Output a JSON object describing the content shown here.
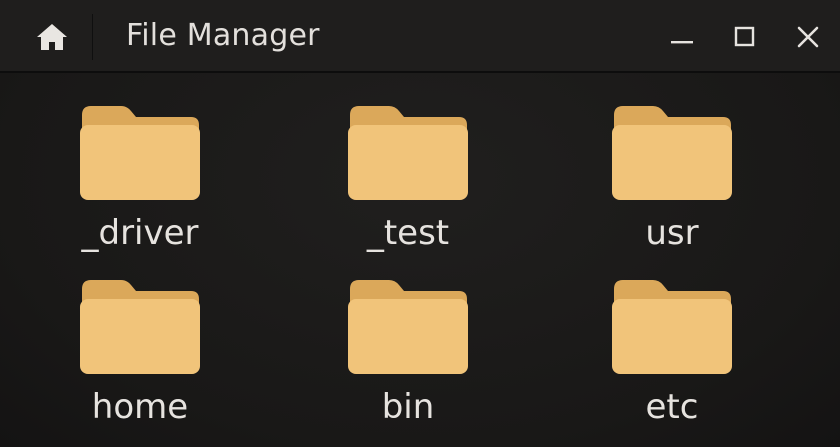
{
  "window": {
    "title": "File Manager"
  },
  "toolbar": {
    "home_icon": "home-icon",
    "minimize_icon": "minimize-icon",
    "maximize_icon": "maximize-icon",
    "close_icon": "close-icon"
  },
  "folders": [
    {
      "name": "_driver",
      "icon": "folder-icon"
    },
    {
      "name": "_test",
      "icon": "folder-icon"
    },
    {
      "name": "usr",
      "icon": "folder-icon"
    },
    {
      "name": "home",
      "icon": "folder-icon"
    },
    {
      "name": "bin",
      "icon": "folder-icon"
    },
    {
      "name": "etc",
      "icon": "folder-icon"
    }
  ],
  "colors": {
    "background": "#1b1a19",
    "titlebar": "#1f1e1d",
    "folder_front": "#f1c47a",
    "folder_back": "#dba85a",
    "text": "#e6e3df"
  }
}
